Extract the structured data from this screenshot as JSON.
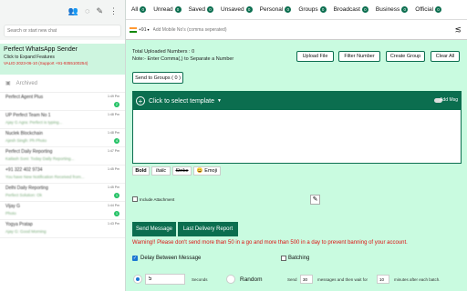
{
  "sidebar": {
    "search_placeholder": "Search or start new chat",
    "sender": {
      "title": "Perfect WhatsApp Sender",
      "subtitle": "Click to Expand Features",
      "valid": "VALID 2023-06-10 (Support +91-9355100254)"
    },
    "archived": "Archived",
    "chats": [
      {
        "name": "Perfect Agent Plus",
        "preview": "",
        "time": "1:49 Pm",
        "badge": "2"
      },
      {
        "name": "UP Perfect Team No 1",
        "preview": "Ajay G Agra: Perfect is typing...",
        "time": "1:48 Pm",
        "badge": ""
      },
      {
        "name": "Nuclek Blockchain",
        "preview": "Ajesh Singh: Ph Photo",
        "time": "1:48 Pm",
        "badge": "4"
      },
      {
        "name": "Perfect Daily Reporting",
        "preview": "Kailash Soni: Today Daily Reporting...",
        "time": "1:47 Pm",
        "badge": ""
      },
      {
        "name": "+91 322 402 9734",
        "preview": "You have New Notification Received from...",
        "time": "1:45 Pm",
        "badge": ""
      },
      {
        "name": "Delhi Daily Reporting",
        "preview": "Perfect Solution: Ok",
        "time": "1:45 Pm",
        "badge": "1"
      },
      {
        "name": "Vijay G",
        "preview": "Photo",
        "time": "1:44 Pm",
        "badge": "1"
      },
      {
        "name": "Yogya Pratap",
        "preview": "Ajay G: Good Morning",
        "time": "1:43 Pm",
        "badge": ""
      }
    ]
  },
  "filters": [
    {
      "label": "All",
      "count": "0"
    },
    {
      "label": "Unread",
      "count": "0"
    },
    {
      "label": "Saved",
      "count": "0"
    },
    {
      "label": "Unsaved",
      "count": "0"
    },
    {
      "label": "Personal",
      "count": "0"
    },
    {
      "label": "Groups",
      "count": "0"
    },
    {
      "label": "Broadcast",
      "count": "0"
    },
    {
      "label": "Business",
      "count": "0"
    },
    {
      "label": "Official",
      "count": "0"
    }
  ],
  "numbers": {
    "country_code": "+91",
    "placeholder": "Add Mobile No's (comma seperated)",
    "total_uploaded": "Total Uploaded Numbers : 0",
    "note": "Note:- Enter Comma(,) to Separate a Number"
  },
  "buttons": {
    "upload_file": "Upload File",
    "filter_number": "Filter Number",
    "create_group": "Create Group",
    "clear_all": "Clear All",
    "send_to_groups": "Send to Groups ( 0 )",
    "send_message": "Send Message",
    "last_delivery_report": "Last Delivery Report"
  },
  "editor": {
    "template_label": "Click to select template",
    "add_label": "Add",
    "msg_label": "Msg"
  },
  "format": {
    "bold": "Bold",
    "italic": "Italic",
    "strike": "Strike",
    "emoji": "😀 Emoji"
  },
  "attachment_label": "Include Attachment",
  "warning": "Warning!! Please don't send more than 50 in a go and more than 500 in a day to prevent banning of your account.",
  "delay": {
    "label": "Delay Between Message",
    "checked": true,
    "seconds_value": "5",
    "seconds_label": "Seconds",
    "random_label": "Random"
  },
  "batching": {
    "label": "Batching",
    "send_label": "Send",
    "messages_value": "30",
    "wait_label": "messages and then wait for",
    "minutes_value": "10",
    "after_label": "minutes after each batch."
  },
  "colors": {
    "brand_green": "#0b6e4f",
    "panel_bg": "#c9fbe0",
    "warning_red": "#dd1111",
    "badge_green": "#25c266"
  }
}
